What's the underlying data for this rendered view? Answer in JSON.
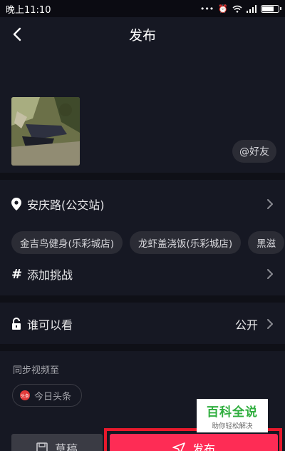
{
  "status_bar": {
    "time": "晚上11:10"
  },
  "nav": {
    "title": "发布"
  },
  "media": {
    "at_friend_label": "@好友"
  },
  "location": {
    "name": "安庆路(公交站)"
  },
  "location_suggestions": [
    "金吉鸟健身(乐彩城店)",
    "龙虾盖浇饭(乐彩城店)",
    "黑滋"
  ],
  "challenge": {
    "label": "添加挑战"
  },
  "visibility": {
    "label": "谁可以看",
    "value": "公开"
  },
  "sync": {
    "label": "同步视频至",
    "target": "今日头条",
    "target_icon_text": "头条"
  },
  "actions": {
    "draft_label": "草稿",
    "publish_label": "发布"
  },
  "watermark": {
    "title": "百科全说",
    "subtitle": "助你轻松解决"
  },
  "colors": {
    "background": "#161823",
    "publish": "#fe2c55",
    "highlight": "#e8192c"
  }
}
